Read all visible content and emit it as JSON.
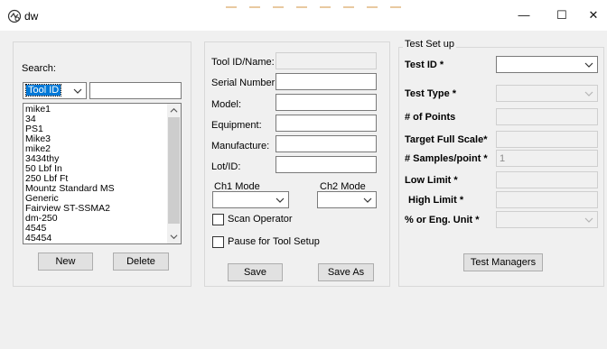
{
  "window": {
    "title": "dw",
    "minimize_glyph": "—",
    "maximize_glyph": "☐",
    "close_glyph": "✕",
    "icon": "app-icon"
  },
  "search_panel": {
    "search_label": "Search:",
    "field_combo": {
      "selected": "Tool ID"
    },
    "search_input": {
      "value": ""
    },
    "tool_list": [
      "mike1",
      "34",
      "PS1",
      "Mike3",
      "mike2",
      "3434thy",
      "50 Lbf In",
      "250 Lbf Ft",
      "Mountz Standard MS",
      "Generic",
      "Fairview ST-SSMA2",
      "dm-250",
      "4545",
      "45454"
    ],
    "new_button": "New",
    "delete_button": "Delete"
  },
  "tool_panel": {
    "tool_id_label": "Tool ID/Name:",
    "serial_label": "Serial Number:",
    "model_label": "Model:",
    "equipment_label": "Equipment:",
    "manufacture_label": "Manufacture:",
    "lot_label": "Lot/ID:",
    "tool_id_value": "",
    "serial_value": "",
    "model_value": "",
    "equipment_value": "",
    "manufacture_value": "",
    "lot_value": "",
    "ch1_mode_label": "Ch1 Mode",
    "ch2_mode_label": "Ch2 Mode",
    "ch1_mode_value": "",
    "ch2_mode_value": "",
    "scan_operator_label": "Scan Operator",
    "pause_label": "Pause for Tool Setup",
    "scan_operator_checked": false,
    "pause_checked": false,
    "save_button": "Save",
    "save_as_button": "Save As"
  },
  "test_setup": {
    "group_title": "Test Set up",
    "test_id_label": "Test ID *",
    "test_type_label": "Test Type *",
    "points_label": "# of Points",
    "full_scale_label": "Target Full Scale*",
    "samples_label": "# Samples/point *",
    "low_limit_label": "Low Limit *",
    "high_limit_label": "High Limit *",
    "unit_label": "% or Eng. Unit *",
    "test_id_value": "",
    "test_type_value": "",
    "points_value": "",
    "full_scale_value": "",
    "samples_value": "1",
    "low_limit_value": "",
    "high_limit_value": "",
    "unit_value": "",
    "test_managers_button": "Test Managers"
  }
}
